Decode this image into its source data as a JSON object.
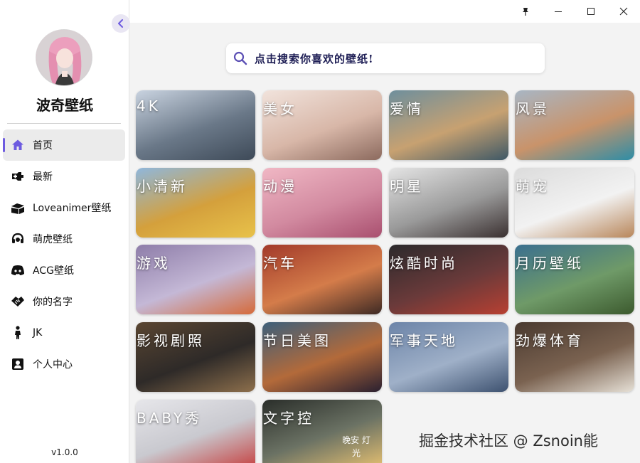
{
  "sidebar": {
    "app_name": "波奇壁纸",
    "version": "v1.0.0",
    "items": [
      {
        "label": "首页",
        "icon": "home-icon"
      },
      {
        "label": "最新",
        "icon": "new-icon"
      },
      {
        "label": "Loveanimer壁纸",
        "icon": "books-icon"
      },
      {
        "label": "萌虎壁纸",
        "icon": "headset-icon"
      },
      {
        "label": "ACG壁纸",
        "icon": "discord-icon"
      },
      {
        "label": "你的名字",
        "icon": "handshake-icon"
      },
      {
        "label": "JK",
        "icon": "person-icon"
      },
      {
        "label": "个人中心",
        "icon": "profile-card-icon"
      }
    ]
  },
  "search": {
    "placeholder": "点击搜索你喜欢的壁纸!"
  },
  "categories": [
    {
      "label": "4K",
      "colors": [
        "#c9d3e0",
        "#6a7888",
        "#3e4a58"
      ]
    },
    {
      "label": "美女",
      "colors": [
        "#f1e3dc",
        "#d8b7a8",
        "#8c6a5e"
      ]
    },
    {
      "label": "爱情",
      "colors": [
        "#6e8f9d",
        "#c7a171",
        "#3e5866"
      ]
    },
    {
      "label": "风景",
      "colors": [
        "#a8b6c4",
        "#c9936a",
        "#2e8da6"
      ]
    },
    {
      "label": "小清新",
      "colors": [
        "#8fb7dc",
        "#d4a03c",
        "#e8c24a"
      ]
    },
    {
      "label": "动漫",
      "colors": [
        "#f0b7c4",
        "#d28aa0",
        "#a94f6f"
      ]
    },
    {
      "label": "明星",
      "colors": [
        "#e4e4e4",
        "#9a9a9a",
        "#3a3030"
      ]
    },
    {
      "label": "萌宠",
      "colors": [
        "#dcdcdc",
        "#f2f2f2",
        "#b8865a"
      ]
    },
    {
      "label": "游戏",
      "colors": [
        "#8e7da9",
        "#c4b8d6",
        "#d56a3a"
      ]
    },
    {
      "label": "汽车",
      "colors": [
        "#a23a2a",
        "#d47c4a",
        "#3e2a24"
      ]
    },
    {
      "label": "炫酷时尚",
      "colors": [
        "#2c2a2c",
        "#6a3a3a",
        "#b84032"
      ]
    },
    {
      "label": "月历壁纸",
      "colors": [
        "#3a6f8f",
        "#6f9a68",
        "#3c5a2e"
      ]
    },
    {
      "label": "影视剧照",
      "colors": [
        "#5a4632",
        "#2e2a28",
        "#8d6f4c"
      ]
    },
    {
      "label": "节日美图",
      "colors": [
        "#3d5f7a",
        "#b36a3a",
        "#2a2030"
      ]
    },
    {
      "label": "军事天地",
      "colors": [
        "#6c84a8",
        "#9fb0c8",
        "#3e5270"
      ]
    },
    {
      "label": "劲爆体育",
      "colors": [
        "#4a3a30",
        "#7a6250",
        "#e6e0d6"
      ]
    },
    {
      "label": "BABY秀",
      "colors": [
        "#e6e6ea",
        "#c9c9cf",
        "#c64e4e"
      ]
    },
    {
      "label": "文字控",
      "colors": [
        "#2a2e2a",
        "#6b7264",
        "#d9b870"
      ]
    }
  ],
  "card_extra_text": "晚安 灯光",
  "watermark": "掘金技术社区 @ Zsnoin能",
  "colors": {
    "accent": "#6d5be0",
    "search_text": "#1e1e55"
  }
}
